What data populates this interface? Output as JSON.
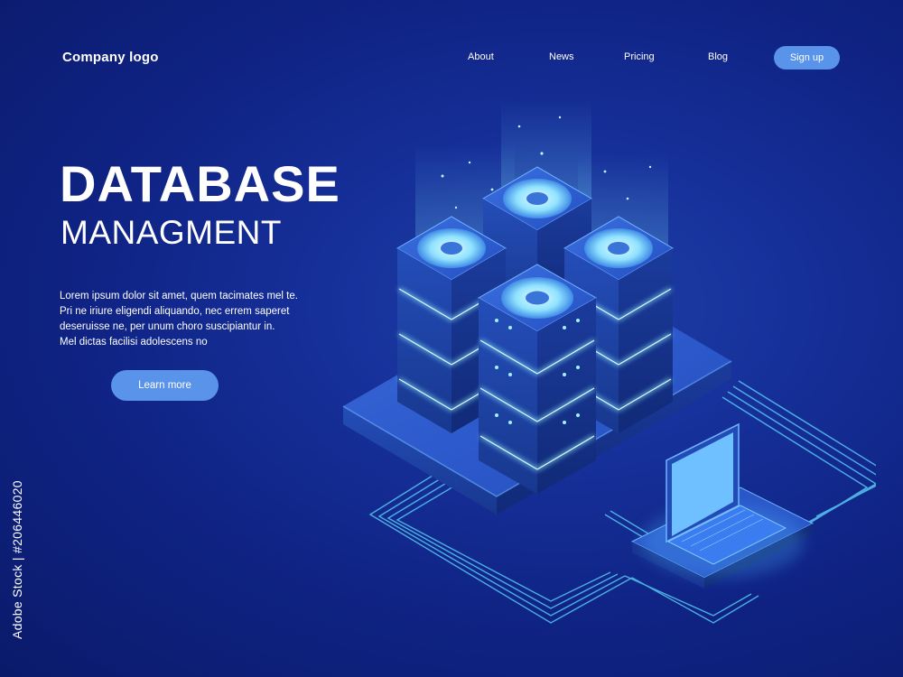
{
  "header": {
    "logo": "Company logo",
    "nav": [
      {
        "label": "About"
      },
      {
        "label": "News"
      },
      {
        "label": "Pricing"
      },
      {
        "label": "Blog"
      }
    ],
    "signup_label": "Sign up"
  },
  "hero": {
    "title": "DATABASE",
    "subtitle": "MANAGMENT",
    "body_lines": [
      "Lorem ipsum dolor sit amet, quem tacimates mel te.",
      "Pri ne iriure eligendi aliquando, nec errem saperet",
      "deseruisse ne, per unum choro suscipiantur in.",
      "Mel dictas facilisi adolescens no"
    ],
    "button_label": "Learn more"
  },
  "stock": {
    "id_text": "Adobe Stock | #206446020"
  },
  "illustration": {
    "icons": [
      "server-rack-icon",
      "cooling-fan-icon",
      "laptop-icon",
      "circuit-lines"
    ],
    "colors": {
      "glow": "#7fe6ff",
      "panel": "#2a56c8",
      "panel_dark": "#16338f",
      "accent": "#5a93ea"
    }
  }
}
